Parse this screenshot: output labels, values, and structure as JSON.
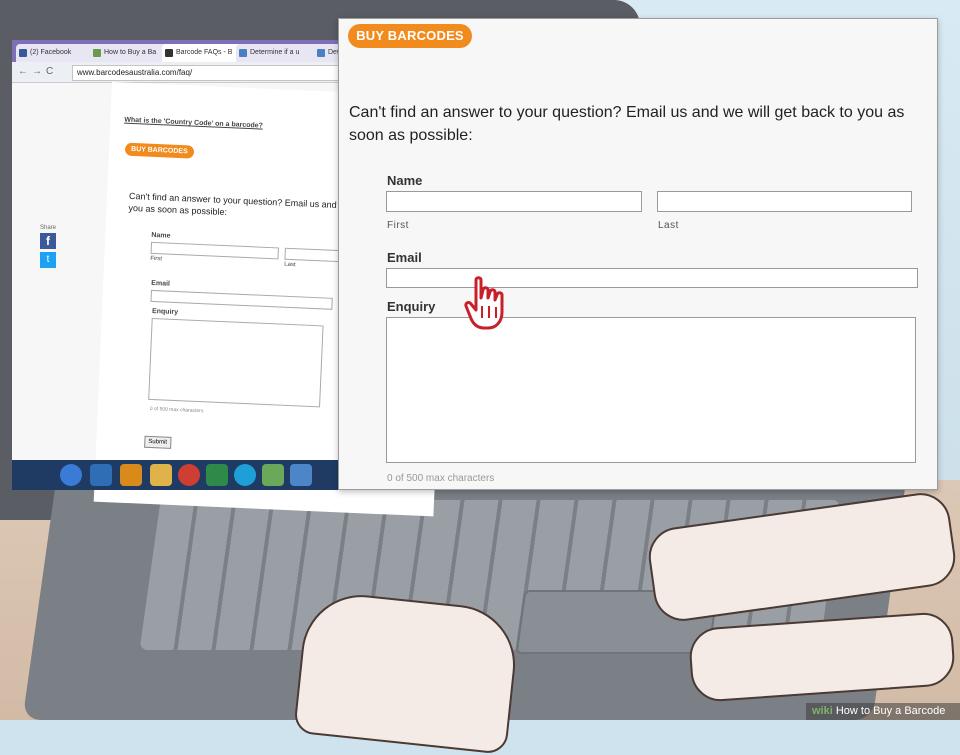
{
  "browser": {
    "tabs": [
      {
        "label": "(2) Facebook",
        "icon": "facebook-icon"
      },
      {
        "label": "How to Buy a Ba",
        "icon": "page-icon"
      },
      {
        "label": "Barcode FAQs - B",
        "icon": "page-icon"
      },
      {
        "label": "Determine if a u",
        "icon": "page-icon"
      },
      {
        "label": "Determin",
        "icon": "page-icon"
      }
    ],
    "url": "www.barcodesaustralia.com/faq/",
    "page_link": "What is the 'Country Code' on a barcode?",
    "share_label": "Share"
  },
  "callout": {
    "cta_label": "BUY BARCODES",
    "prompt": "Can't find an answer to your question? Email us and we will get back to you as soon as possible:",
    "name_label": "Name",
    "first_label": "First",
    "last_label": "Last",
    "email_label": "Email",
    "enquiry_label": "Enquiry",
    "counter": "0 of 500 max characters"
  },
  "mini_form": {
    "cta_label": "BUY BARCODES",
    "prompt": "Can't find an answer to your question? Email us and we",
    "prompt2": "you as soon as possible:",
    "name_label": "Name",
    "first_label": "First",
    "last_label": "Last",
    "email_label": "Email",
    "enquiry_label": "Enquiry",
    "counter": "0 of 500 max characters",
    "submit_label": "Submit"
  },
  "colors": {
    "accent": "#f28b1e",
    "browser_frame": "#7f6fb8"
  },
  "watermark": {
    "prefix": "wiki",
    "title": "How to Buy a Barcode"
  }
}
